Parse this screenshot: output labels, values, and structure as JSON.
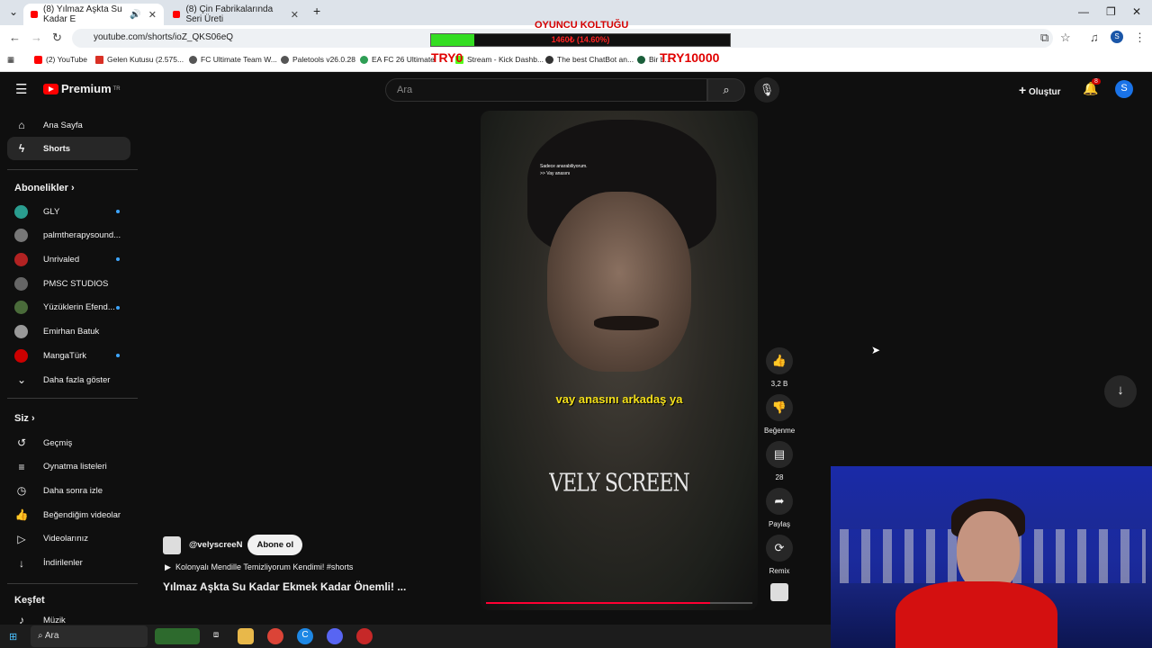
{
  "browser": {
    "tabs": [
      {
        "title": "(8) Yılmaz Aşkta Su Kadar E",
        "active": true
      },
      {
        "title": "(8) Çin Fabrikalarında Seri Üreti",
        "active": false
      }
    ],
    "url": "youtube.com/shorts/ioZ_QKS06eQ",
    "bookmarks": [
      {
        "label": "(2) YouTube",
        "color": "#ff0000"
      },
      {
        "label": "Gelen Kutusu (2.575...",
        "color": "#d93025"
      },
      {
        "label": "FC Ultimate Team W...",
        "color": "#555555"
      },
      {
        "label": "Paletools v26.0.28",
        "color": "#555555"
      },
      {
        "label": "EA FC 26 Ultimate",
        "color": "#2e9e55"
      },
      {
        "label": "Stream - Kick Dashb...",
        "color": "#53fc18"
      },
      {
        "label": "The best ChatBot an...",
        "color": "#333333"
      },
      {
        "label": "Bir b...",
        "color": "#1a5e3a"
      }
    ]
  },
  "overlay": {
    "title": "OYUNCU KOLTUĞU",
    "bar_text": "1460₺ (14.60%)",
    "progress_percent": 14.6,
    "left_label": "TRY0",
    "right_label": "TRY10000"
  },
  "youtube": {
    "logo_text": "Premium",
    "region": "TR",
    "search_placeholder": "Ara",
    "create_label": "Oluştur",
    "notification_count": "8",
    "avatar_letter": "S"
  },
  "sidebar": {
    "main": [
      {
        "label": "Ana Sayfa",
        "icon": "home-icon",
        "glyph": "⌂"
      },
      {
        "label": "Shorts",
        "icon": "shorts-icon",
        "glyph": "ϟ",
        "selected": true
      }
    ],
    "subs_header": "Abonelikler",
    "subscriptions": [
      {
        "label": "GLY",
        "color": "#2a9d8f",
        "dot": true
      },
      {
        "label": "palmtherapysound...",
        "color": "#777777",
        "dot": false
      },
      {
        "label": "Unrivaled",
        "color": "#b22222",
        "dot": true
      },
      {
        "label": "PMSC STUDIOS",
        "color": "#666666",
        "dot": false
      },
      {
        "label": "Yüzüklerin Efend...",
        "color": "#4a6b3a",
        "dot": true
      },
      {
        "label": "Emirhan Batuk",
        "color": "#999999",
        "dot": false
      },
      {
        "label": "MangaTürk",
        "color": "#cc0000",
        "dot": true
      }
    ],
    "show_more": "Daha fazla göster",
    "you_header": "Siz",
    "you_items": [
      {
        "label": "Geçmiş",
        "icon": "history-icon",
        "glyph": "↺"
      },
      {
        "label": "Oynatma listeleri",
        "icon": "playlists-icon",
        "glyph": "≡"
      },
      {
        "label": "Daha sonra izle",
        "icon": "watch-later-icon",
        "glyph": "◷"
      },
      {
        "label": "Beğendiğim videolar",
        "icon": "liked-icon",
        "glyph": "👍"
      },
      {
        "label": "Videolarınız",
        "icon": "your-videos-icon",
        "glyph": "▷"
      },
      {
        "label": "İndirilenler",
        "icon": "downloads-icon",
        "glyph": "↓"
      }
    ],
    "explore_header": "Keşfet",
    "explore_items": [
      {
        "label": "Müzik",
        "icon": "music-icon",
        "glyph": "♪"
      }
    ]
  },
  "short": {
    "subtitle_small_1": "Sadece anarabiliyorum.",
    "subtitle_small_2": ">> Vay anasını",
    "subtitle_main": "vay anasını arkadaş ya",
    "watermark": "VELY SCREEN",
    "progress_fraction": 0.84,
    "channel": "@velyscreeN",
    "subscribe_label": "Abone ol",
    "playlist_line": "Kolonyalı Mendille Temizliyorum Kendimi! #shorts",
    "title": "Yılmaz Aşkta Su Kadar Ekmek Kadar Önemli! ..."
  },
  "actions": {
    "like_count": "3,2 B",
    "dislike_label": "Beğenme",
    "comment_count": "28",
    "share_label": "Paylaş",
    "remix_label": "Remix"
  },
  "taskbar": {
    "search_label": "Ara"
  }
}
